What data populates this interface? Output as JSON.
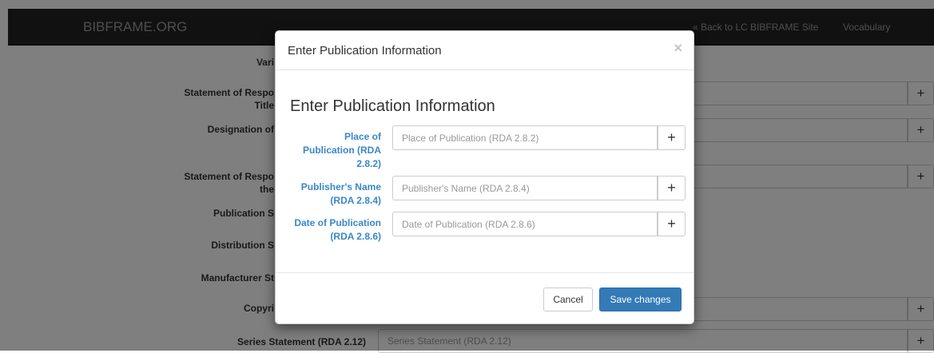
{
  "navbar": {
    "brand": "BIBFRAME.ORG",
    "back_link": "« Back to LC BIBFRAME Site",
    "vocabulary_link": "Vocabulary"
  },
  "background_form": {
    "labels": {
      "variant": "Vari",
      "resp1_line1": "Statement of Respo",
      "resp1_line2": "Title",
      "designation": "Designation of",
      "resp2_line1": "Statement of Respo",
      "resp2_line2": "the",
      "publication": "Publication S",
      "distribution": "Distribution S",
      "manufacturer": "Manufacturer St",
      "copyright": "Copyri",
      "series": "Series Statement (RDA 2.12)"
    },
    "series_placeholder": "Series Statement (RDA 2.12)",
    "plus": "+"
  },
  "modal": {
    "header_title": "Enter Publication Information",
    "close": "×",
    "section_title": "Enter Publication Information",
    "fields": [
      {
        "label_line1": "Place of",
        "label_line2": "Publication (RDA",
        "label_line3": "2.8.2)",
        "placeholder": "Place of Publication (RDA 2.8.2)"
      },
      {
        "label_line1": "Publisher's Name",
        "label_line2": "(RDA 2.8.4)",
        "placeholder": "Publisher's Name (RDA 2.8.4)"
      },
      {
        "label_line1": "Date of Publication",
        "label_line2": "(RDA 2.8.6)",
        "placeholder": "Date of Publication (RDA 2.8.6)"
      }
    ],
    "add_button": "+",
    "cancel_label": "Cancel",
    "save_label": "Save changes"
  },
  "colors": {
    "navbar_bg": "#222222",
    "label_blue": "#3a87c8",
    "primary_button": "#337ab7"
  }
}
